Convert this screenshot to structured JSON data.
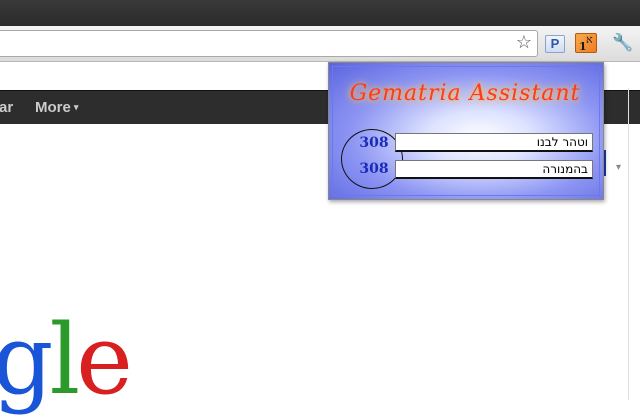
{
  "toolbar": {
    "icons": [
      "star-icon",
      "p-extension-icon",
      "gematria-extension-icon",
      "wrench-icon"
    ],
    "gem_icon_letters": {
      "top": "א",
      "bottom": "1"
    },
    "p_label": "P"
  },
  "gbar": {
    "items": [
      "ar",
      "More"
    ],
    "more_caret": "▾"
  },
  "logo": {
    "g": "g",
    "l": "l",
    "e": "e"
  },
  "popup": {
    "title": "Gematria Assistant",
    "rows": [
      {
        "value": "308",
        "text": "וטהר לבנו"
      },
      {
        "value": "308",
        "text": "בהמנורה"
      }
    ]
  },
  "colors": {
    "title": "#ff3d10",
    "numbers": "#1a2bb8",
    "gbar_bg": "#2d2d2d"
  }
}
